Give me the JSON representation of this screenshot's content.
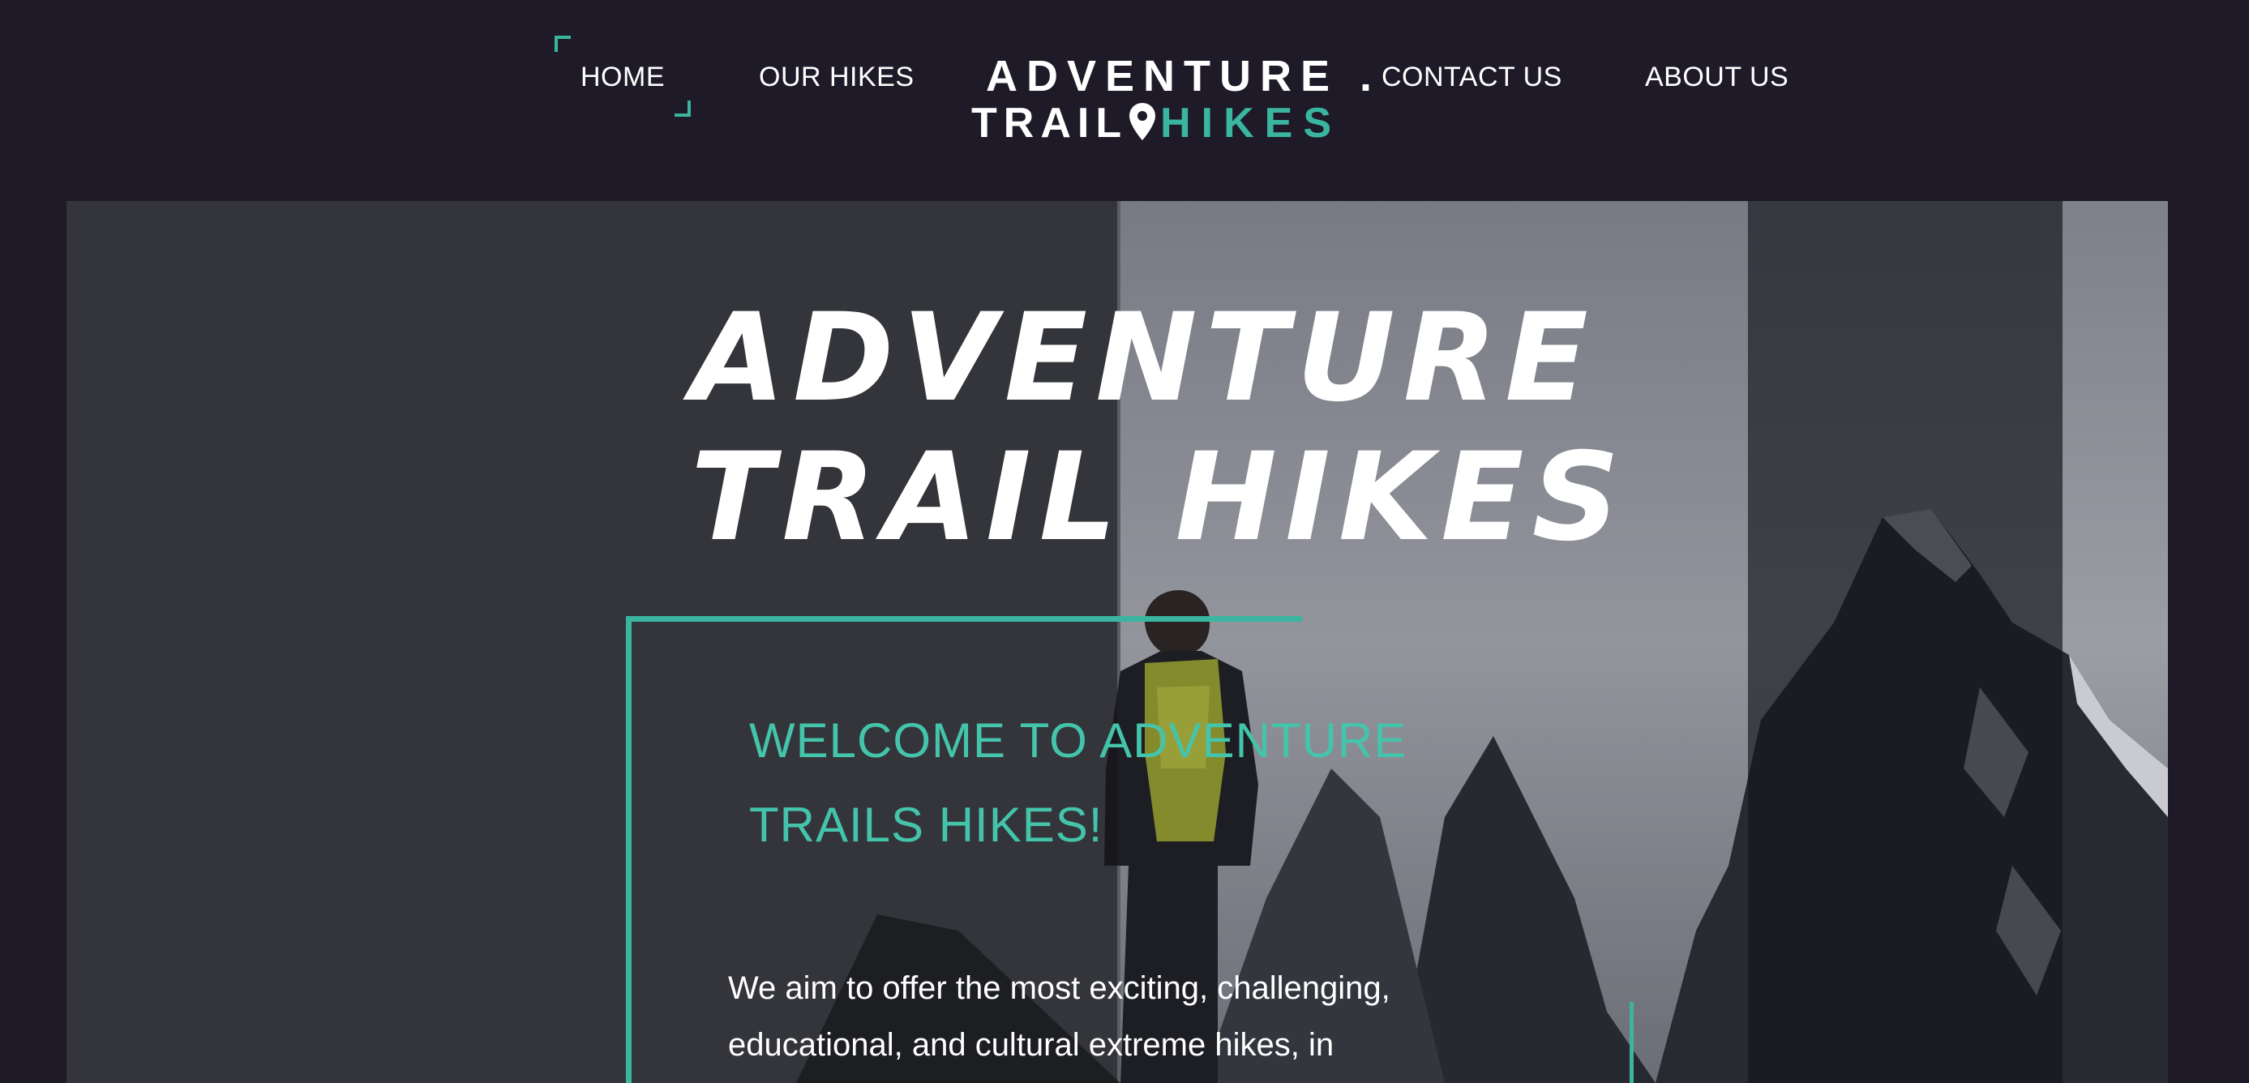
{
  "nav": {
    "links": [
      {
        "label": "HOME",
        "active": true
      },
      {
        "label": "OUR HIKES"
      },
      {
        "label": "CONTACT US"
      },
      {
        "label": "ABOUT US"
      }
    ]
  },
  "logo": {
    "line1": "ADVENTURE .",
    "line2_left": "TRAIL",
    "line2_right": "HIKES",
    "icon": "map-pin-icon"
  },
  "hero": {
    "title_line1": "ADVENTURE",
    "title_line2": "TRAIL HIKES",
    "welcome_line1": "WELCOME TO ADVENTURE",
    "welcome_line2": "TRAILS HIKES!",
    "body_line1": "We aim to offer the most exciting, challenging,",
    "body_line2": "educational, and cultural extreme hikes, in"
  },
  "colors": {
    "background": "#1f1a28",
    "accent": "#3ab5a0",
    "text": "#ffffff"
  }
}
